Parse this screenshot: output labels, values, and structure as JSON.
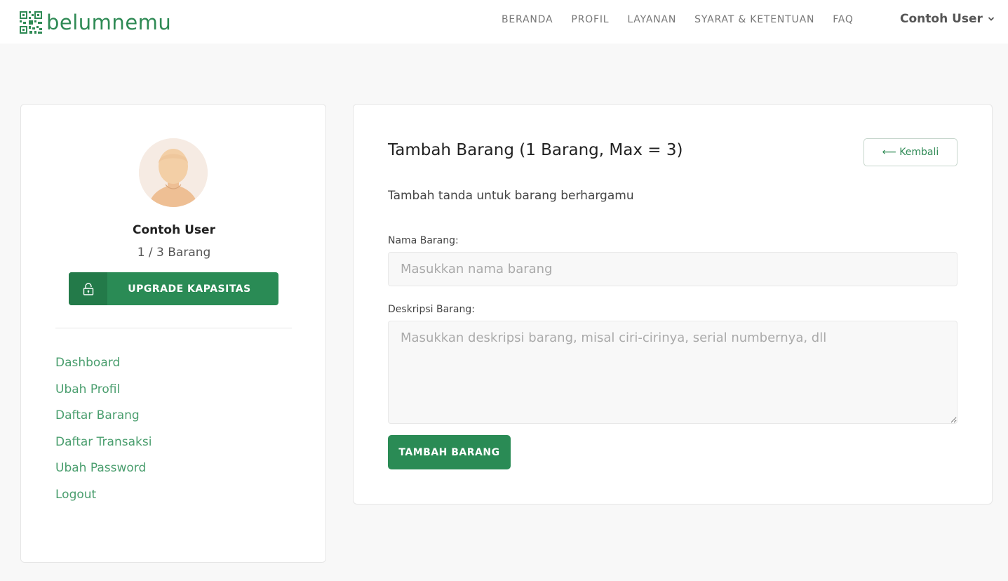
{
  "navbar": {
    "brand": "belumnemu",
    "links": [
      "BERANDA",
      "PROFIL",
      "LAYANAN",
      "SYARAT & KETENTUAN",
      "FAQ"
    ],
    "user_menu": "Contoh User"
  },
  "sidebar": {
    "user_name": "Contoh User",
    "item_count": "1 / 3 Barang",
    "upgrade_label": "UPGRADE KAPASITAS",
    "menu": [
      "Dashboard",
      "Ubah Profil",
      "Daftar Barang",
      "Daftar Transaksi",
      "Ubah Password",
      "Logout"
    ]
  },
  "main": {
    "title": "Tambah Barang (1 Barang, Max = 3)",
    "back_label": "⟵ Kembali",
    "subtitle": "Tambah tanda untuk barang berhargamu",
    "name_label": "Nama Barang:",
    "name_placeholder": "Masukkan nama barang",
    "name_value": "",
    "desc_label": "Deskripsi Barang:",
    "desc_placeholder": "Masukkan deskripsi barang, misal ciri-cirinya, serial numbernya, dll",
    "desc_value": "",
    "submit_label": "TAMBAH BARANG"
  },
  "colors": {
    "brand_green": "#2a8b55",
    "link_green": "#4a9e6e",
    "background": "#f8f8f8"
  },
  "icons": {
    "logo": "qr-code-icon",
    "user_chevron": "chevron-down-icon",
    "upgrade": "lock-icon"
  }
}
